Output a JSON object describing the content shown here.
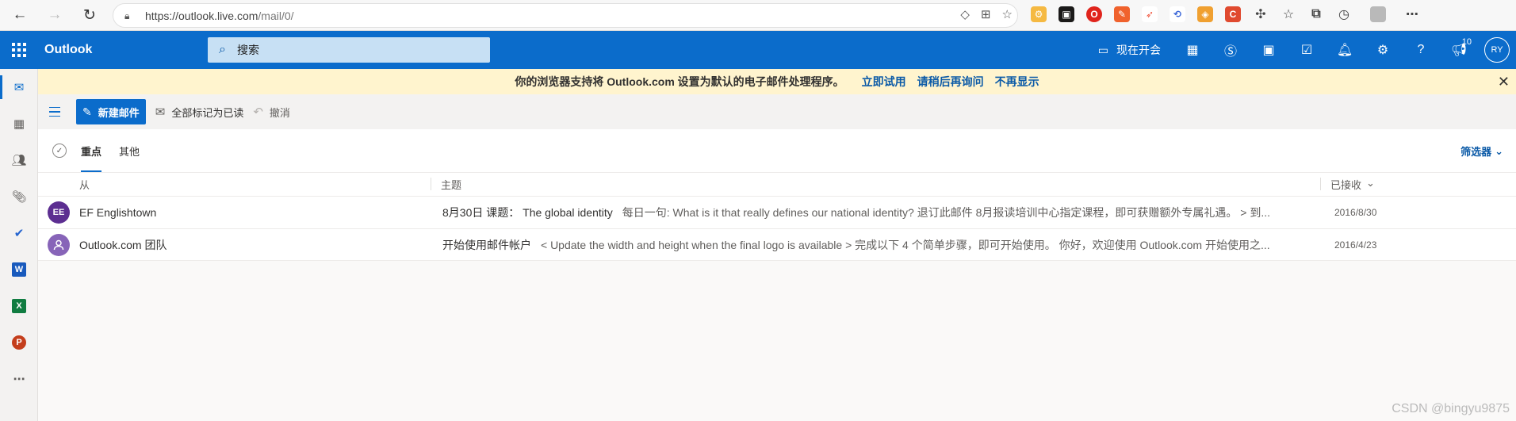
{
  "browser": {
    "url_main": "https://outlook.live.com",
    "url_path": "/mail/0/"
  },
  "header": {
    "brand": "Outlook",
    "search_placeholder": "搜索",
    "meet_label": "现在开会",
    "notifications_badge": "10",
    "user_initials": "RY"
  },
  "rail": {
    "apps": [
      "mail",
      "calendar",
      "people",
      "attachments",
      "todo",
      "word",
      "excel",
      "powerpoint",
      "more"
    ]
  },
  "banner": {
    "message": "你的浏览器支持将 Outlook.com 设置为默认的电子邮件处理程序。",
    "try_now": "立即试用",
    "ask_later": "请稍后再询问",
    "dont_show": "不再显示"
  },
  "toolbar": {
    "new_mail": "新建邮件",
    "mark_all_read": "全部标记为已读",
    "undo": "撤消"
  },
  "tabs": {
    "focused": "重点",
    "other": "其他",
    "filter": "筛选器"
  },
  "columns": {
    "from": "从",
    "subject": "主题",
    "received": "已接收"
  },
  "messages": [
    {
      "initials": "EE",
      "avatar_color": "#5c2e91",
      "from": "EF Englishtown",
      "subject": "8月30日 课题： The global identity",
      "preview": "每日一句: What is it that really defines our national identity? 退订此邮件 8月报读培训中心指定课程，即可获赠额外专属礼遇。 > 到...",
      "date": "2016/8/30"
    },
    {
      "initials": "",
      "avatar_color": "#8764b8",
      "from": "Outlook.com 团队",
      "subject": "开始使用邮件帐户",
      "preview": "< Update the width and height when the final logo is available > 完成以下 4 个简单步骤，即可开始使用。 你好，欢迎使用 Outlook.com 开始使用之...",
      "date": "2016/4/23"
    }
  ],
  "watermark": "CSDN @bingyu9875"
}
